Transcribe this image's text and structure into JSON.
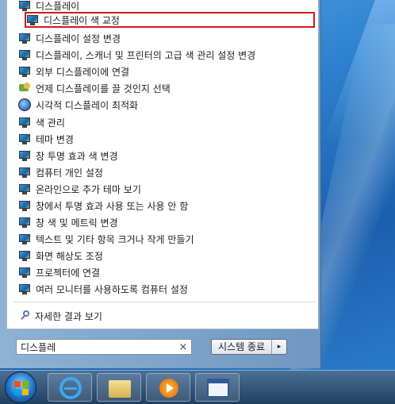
{
  "search_results": [
    {
      "label": "디스플레이",
      "icon": "monitor-icon"
    },
    {
      "label": "디스플레이 색 교정",
      "icon": "monitor-icon",
      "selected": true
    },
    {
      "label": "디스플레이 설정 변경",
      "icon": "monitor-icon"
    },
    {
      "label": "디스플레이, 스캐너 및 프린터의 고급 색 관리 설정 변경",
      "icon": "monitor-icon"
    },
    {
      "label": "외부 디스플레이에 연결",
      "icon": "monitor-icon"
    },
    {
      "label": "언제 디스플레이를 끌 것인지 선택",
      "icon": "power-options-icon"
    },
    {
      "label": "시각적 디스플레이 최적화",
      "icon": "ease-of-access-icon"
    },
    {
      "label": "색 관리",
      "icon": "monitor-icon"
    },
    {
      "label": "테마 변경",
      "icon": "monitor-icon"
    },
    {
      "label": "창 투명 효과 색 변경",
      "icon": "monitor-icon"
    },
    {
      "label": "컴퓨터 개인 설정",
      "icon": "monitor-icon"
    },
    {
      "label": "온라인으로 추가 테마 보기",
      "icon": "monitor-icon"
    },
    {
      "label": "창에서 투명 효과 사용 또는 사용 안 함",
      "icon": "monitor-icon"
    },
    {
      "label": "창 색 및 메트릭 변경",
      "icon": "monitor-icon"
    },
    {
      "label": "텍스트 및 기타 항목 크거나 작게 만들기",
      "icon": "monitor-icon"
    },
    {
      "label": "화면 해상도 조정",
      "icon": "monitor-icon"
    },
    {
      "label": "프로젝터에 연결",
      "icon": "monitor-icon"
    },
    {
      "label": "여러 모니터를 사용하도록 컴퓨터 설정",
      "icon": "monitor-icon"
    }
  ],
  "see_more": {
    "label": "자세한 결과 보기",
    "icon": "search-icon"
  },
  "search": {
    "value": "디스플레",
    "clear_icon": "×"
  },
  "shutdown": {
    "label": "시스템 종료",
    "arrow": "▸"
  },
  "taskbar": {
    "items": [
      "start-button",
      "internet-explorer",
      "windows-explorer",
      "media-player",
      "window"
    ]
  },
  "colors": {
    "selection_border": "#d11a1a",
    "taskbar": "#22405f"
  }
}
